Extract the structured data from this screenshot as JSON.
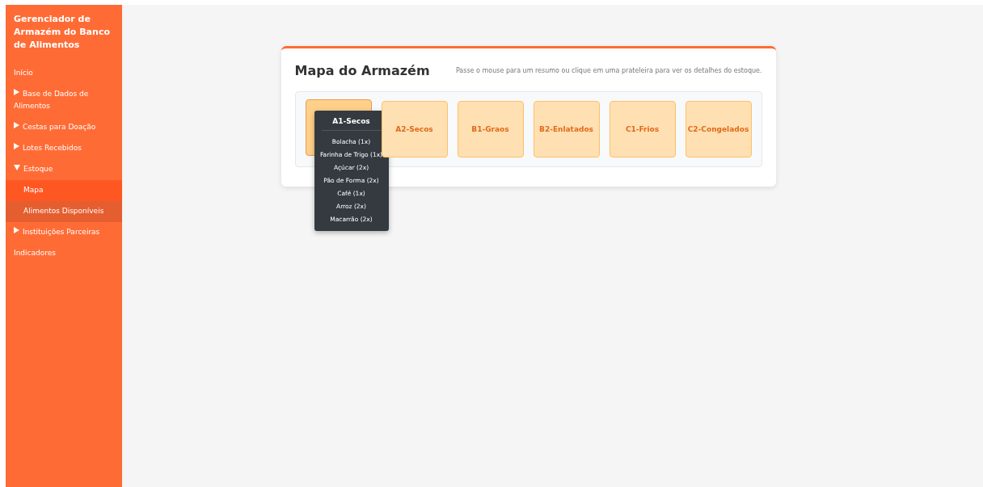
{
  "sidebar": {
    "title": "Gerenciador de Armazém do Banco de Alimentos",
    "items": [
      {
        "kind": "link",
        "label": "Início"
      },
      {
        "kind": "group",
        "label": "Base de Dados de Alimentos",
        "expanded": false
      },
      {
        "kind": "group",
        "label": "Cestas para Doação",
        "expanded": false
      },
      {
        "kind": "group",
        "label": "Lotes Recebidos",
        "expanded": false
      },
      {
        "kind": "group",
        "label": "Estoque",
        "expanded": true,
        "children": [
          {
            "label": "Mapa",
            "selected": true
          },
          {
            "label": "Alimentos Disponíveis",
            "selected": false
          }
        ]
      },
      {
        "kind": "group",
        "label": "Instituições Parceiras",
        "expanded": false
      },
      {
        "kind": "link",
        "label": "Indicadores"
      }
    ]
  },
  "map": {
    "title": "Mapa do Armazém",
    "hint": "Passe o mouse para um resumo ou clique em uma prateleira para ver os detalhes do estoque.",
    "shelves": [
      {
        "hovered": true,
        "tooltip": {
          "title": "A1-Secos",
          "items": [
            "Bolacha (1x)",
            "Farinha de Trigo (1x)",
            "Açúcar (2x)",
            "Pão de Forma (2x)",
            "Café (1x)",
            "Arroz (2x)",
            "Macarrão (2x)"
          ]
        }
      },
      {
        "label": "A2-Secos",
        "hovered": false
      },
      {
        "label": "B1-Graos",
        "hovered": false
      },
      {
        "label": "B2-Enlatados",
        "hovered": false
      },
      {
        "label": "C1-Frios",
        "hovered": false
      },
      {
        "label": "C2-Congelados",
        "hovered": false
      }
    ]
  }
}
